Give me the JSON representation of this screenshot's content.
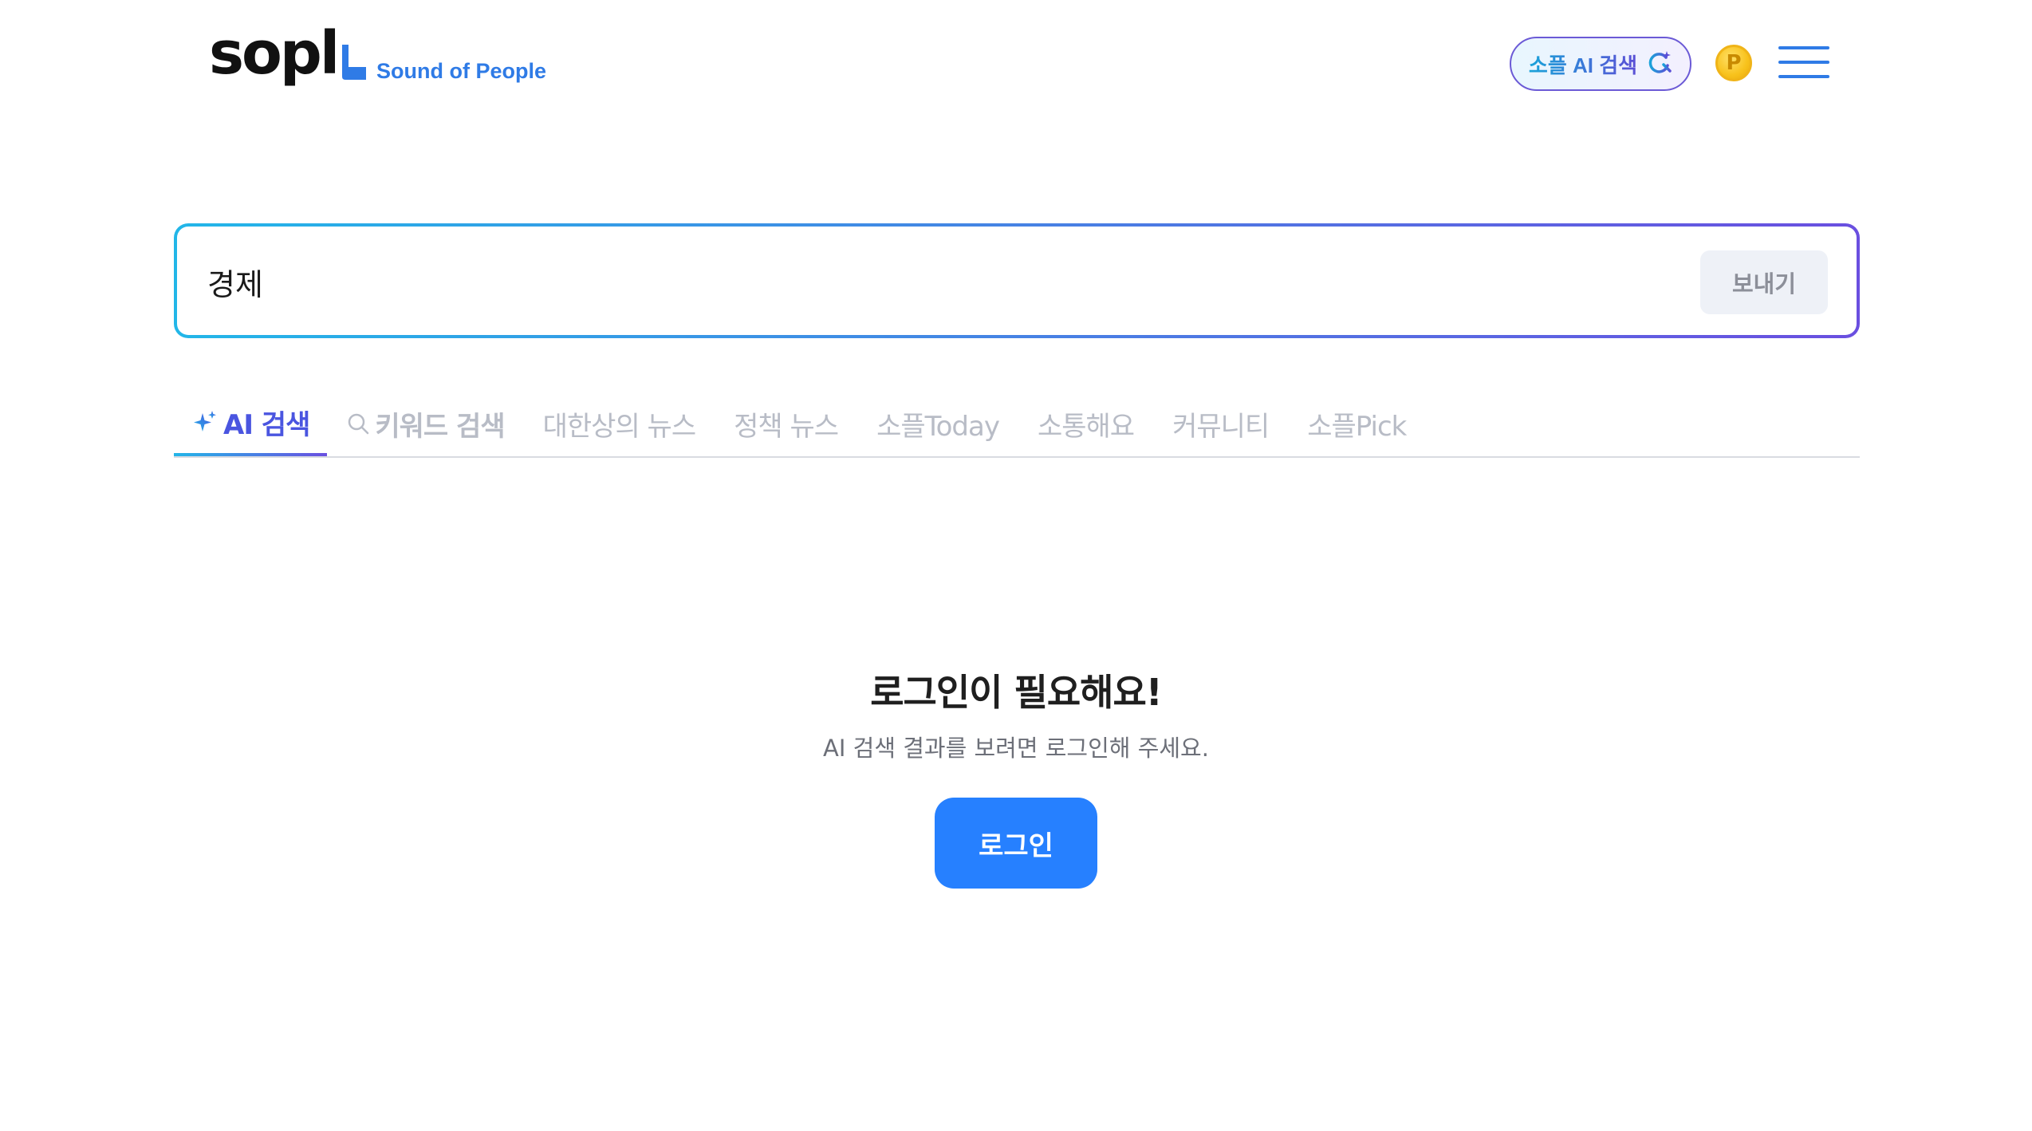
{
  "header": {
    "logo_text": "sopl",
    "tagline": "Sound of People",
    "ai_search_button": "소플 AI 검색",
    "point_symbol": "P",
    "menu_icon": "hamburger-menu-icon"
  },
  "search": {
    "value": "경제",
    "send_label": "보내기"
  },
  "tabs": [
    {
      "label": "AI 검색",
      "icon": "sparkle-icon",
      "active": true
    },
    {
      "label": "키워드 검색",
      "icon": "search-icon",
      "active": false
    },
    {
      "label": "대한상의 뉴스",
      "active": false
    },
    {
      "label": "정책 뉴스",
      "active": false
    },
    {
      "label": "소플Today",
      "active": false
    },
    {
      "label": "소통해요",
      "active": false
    },
    {
      "label": "커뮤니티",
      "active": false
    },
    {
      "label": "소플Pick",
      "active": false
    }
  ],
  "notice": {
    "title": "로그인이 필요해요!",
    "description": "AI 검색 결과를 보려면 로그인해 주세요.",
    "login_label": "로그인"
  },
  "colors": {
    "brand_blue": "#2f7be6",
    "gradient_start": "#22b6e8",
    "gradient_end": "#6a4fe0",
    "login_button": "#2680ff"
  }
}
